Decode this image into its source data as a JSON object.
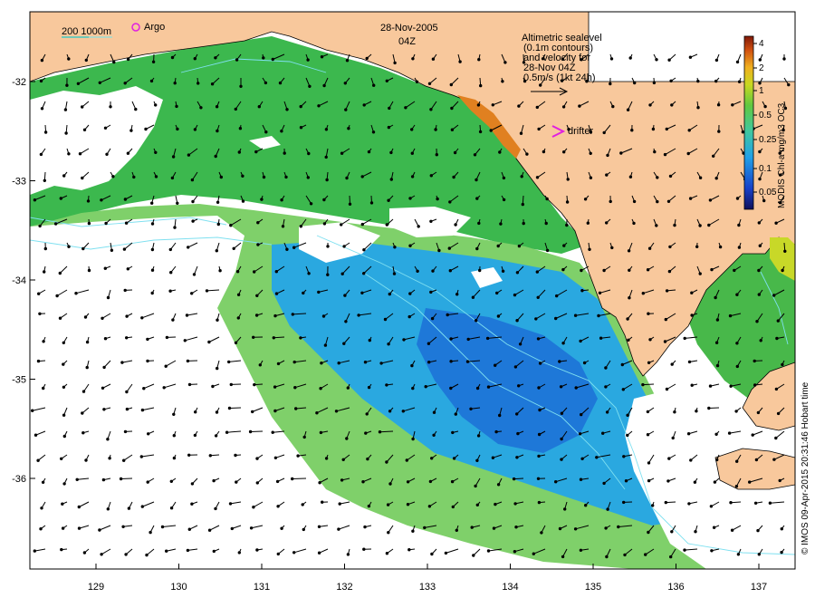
{
  "header": {
    "date": "28-Nov-2005",
    "time": "04Z"
  },
  "scale_bar": {
    "label": "200 1000m"
  },
  "legend": {
    "argo": "Argo",
    "drifter": "drifter",
    "sealevel_lines": [
      "Altimetric sealevel",
      "(0.1m contours)",
      "and velocity for",
      "28-Nov 04Z",
      "0.5m/s (1kt 24h)"
    ]
  },
  "colorbar": {
    "title": "MODIS Chl-a mg/m3 OC3",
    "ticks": [
      "4",
      "2",
      "1",
      "0.5",
      "0.25",
      "0.1",
      "0.05"
    ]
  },
  "axes": {
    "x_ticks": [
      "129",
      "130",
      "131",
      "132",
      "133",
      "134",
      "135",
      "136",
      "137"
    ],
    "y_ticks": [
      "-32",
      "-33",
      "-34",
      "-35",
      "-36"
    ]
  },
  "credit": "© IMOS 09-Apr-2015 20:31:46 Hobart time",
  "colors": {
    "land": "#F8C89C",
    "ocean_high": "#22A84A",
    "ocean_mid": "#5EC65A",
    "ocean_low": "#25A6E0",
    "ocean_deep": "#1E64D8",
    "cloud": "#FFFFFF",
    "argo": "#E020E0",
    "drifter": "#E020E0",
    "contour": "#7FE0F0"
  }
}
